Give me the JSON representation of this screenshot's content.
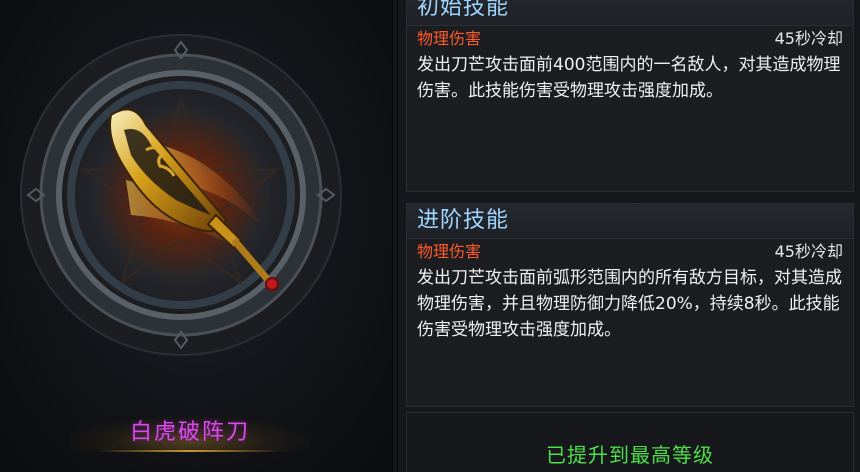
{
  "weapon": {
    "name": "白虎破阵刀"
  },
  "skills": {
    "initial": {
      "header": "初始技能",
      "type": "物理伤害",
      "cooldown": "45秒冷却",
      "description": "发出刀芒攻击面前400范围内的一名敌人，对其造成物理伤害。此技能伤害受物理攻击强度加成。"
    },
    "advanced": {
      "header": "进阶技能",
      "type": "物理伤害",
      "cooldown": "45秒冷却",
      "description": "发出刀芒攻击面前弧形范围内的所有敌方目标，对其造成物理伤害，并且物理防御力降低20%，持续8秒。此技能伤害受物理攻击强度加成。"
    }
  },
  "status": {
    "max_level": "已提升到最高等级"
  },
  "colors": {
    "section_header": "#9fd6ff",
    "damage_type": "#ff5a2a",
    "weapon_name": "#d64de8",
    "max_level": "#4ee04a"
  },
  "icons": {
    "weapon": "golden-blade-icon",
    "emblem": "stone-ring-emblem"
  }
}
